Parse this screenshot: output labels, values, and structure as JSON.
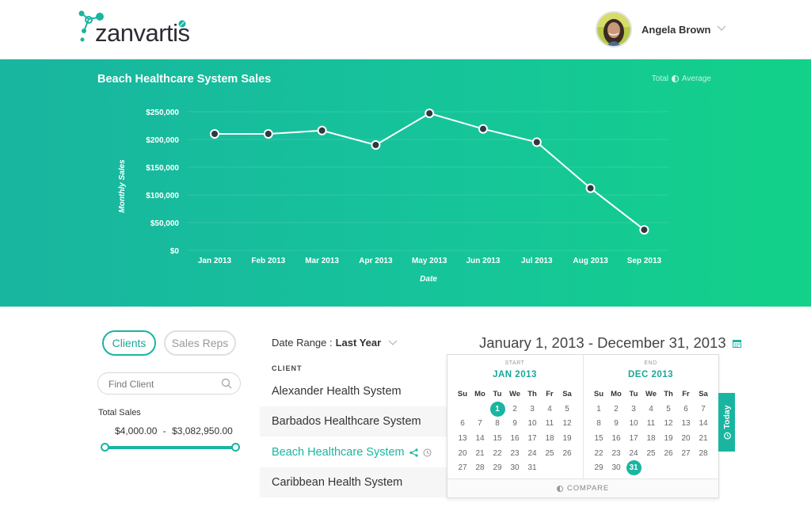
{
  "header": {
    "logo_text": "zanvartis",
    "user_name": "Angela Brown"
  },
  "hero": {
    "title": "Beach Healthcare System Sales",
    "legend": {
      "total_label": "Total",
      "average_label": "Average"
    }
  },
  "chart_data": {
    "type": "line",
    "title": "Beach Healthcare System Sales",
    "xlabel": "Date",
    "ylabel": "Monthly Sales",
    "categories": [
      "Jan 2013",
      "Feb 2013",
      "Mar 2013",
      "Apr 2013",
      "May 2013",
      "Jun 2013",
      "Jul 2013",
      "Aug 2013",
      "Sep 2013"
    ],
    "values": [
      210000,
      210000,
      216000,
      190000,
      247000,
      219000,
      195000,
      112000,
      37000
    ],
    "yticks": [
      0,
      50000,
      100000,
      150000,
      200000,
      250000
    ],
    "ytick_labels": [
      "$0",
      "$50,000",
      "$100,000",
      "$150,000",
      "$200,000",
      "$250,000"
    ],
    "ylim": [
      0,
      250000
    ],
    "grid": true,
    "colors": {
      "line": "#ffffff",
      "marker_fill": "#2e3a40",
      "marker_stroke": "#ffffff"
    }
  },
  "filters": {
    "tab_clients": "Clients",
    "tab_sales_reps": "Sales Reps",
    "find_placeholder": "Find Client",
    "total_sales_label": "Total Sales",
    "total_sales_min": "$4,000.00",
    "total_sales_sep": "-",
    "total_sales_max": "$3,082,950.00"
  },
  "date_range": {
    "label": "Date Range :",
    "value": "Last Year",
    "display": "January 1, 2013 - December 31, 2013"
  },
  "clients": {
    "header": "CLIENT",
    "rows": [
      "Alexander Health System",
      "Barbados Healthcare System",
      "Beach Healthcare System",
      "Caribbean Health System"
    ],
    "active_index": 2
  },
  "calendar": {
    "start_caption": "START",
    "end_caption": "END",
    "start_title": "JAN  2013",
    "end_title": "DEC  2013",
    "weekdays": [
      "Su",
      "Mo",
      "Tu",
      "We",
      "Th",
      "Fr",
      "Sa"
    ],
    "start_days": [
      [
        "",
        "",
        "1",
        "2",
        "3",
        "4",
        "5"
      ],
      [
        "6",
        "7",
        "8",
        "9",
        "10",
        "11",
        "12"
      ],
      [
        "13",
        "14",
        "15",
        "16",
        "17",
        "18",
        "19"
      ],
      [
        "20",
        "21",
        "22",
        "23",
        "24",
        "25",
        "26"
      ],
      [
        "27",
        "28",
        "29",
        "30",
        "31",
        "",
        ""
      ]
    ],
    "end_days": [
      [
        "1",
        "2",
        "3",
        "4",
        "5",
        "6",
        "7"
      ],
      [
        "8",
        "9",
        "10",
        "11",
        "12",
        "13",
        "14"
      ],
      [
        "15",
        "16",
        "17",
        "18",
        "19",
        "20",
        "21"
      ],
      [
        "22",
        "23",
        "24",
        "25",
        "26",
        "27",
        "28"
      ],
      [
        "29",
        "30",
        "31",
        "",
        "",
        "",
        ""
      ]
    ],
    "start_selected": "1",
    "end_selected": "31",
    "compare_label": "COMPARE",
    "today_label": "Today"
  },
  "colors": {
    "accent": "#19b5a0",
    "gradient_start": "#18b59f",
    "gradient_end": "#12d188"
  }
}
